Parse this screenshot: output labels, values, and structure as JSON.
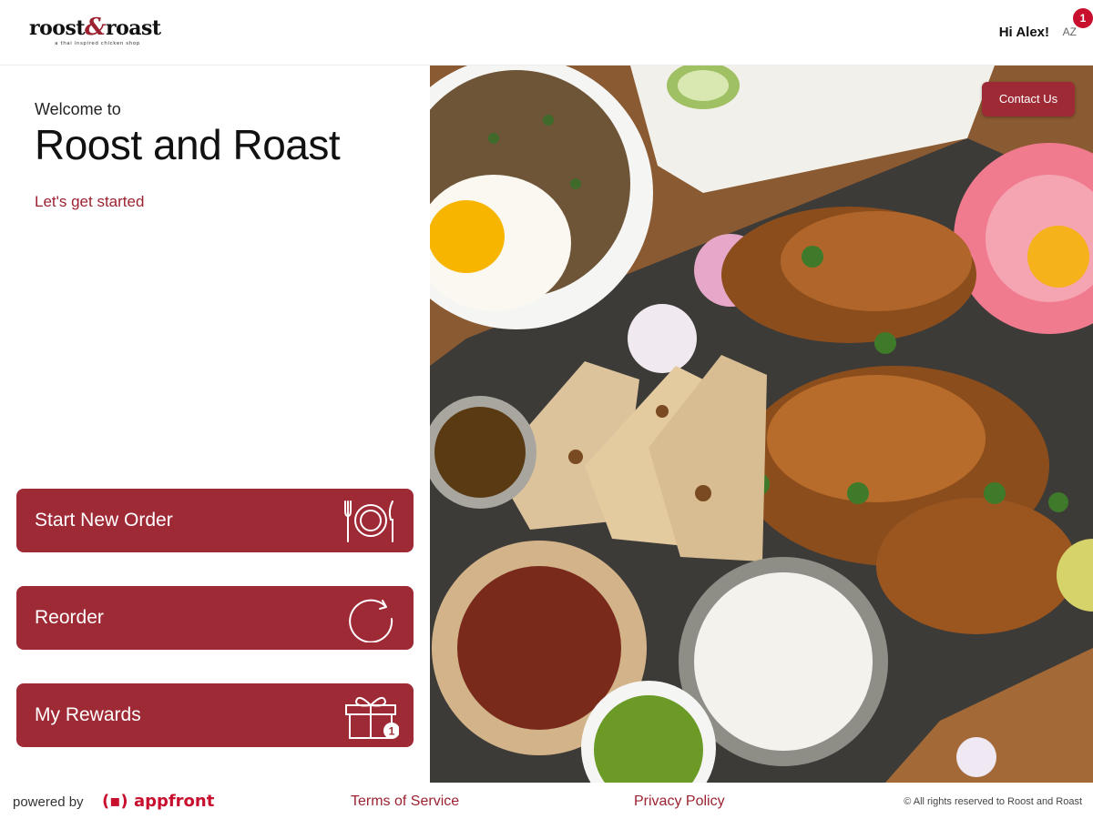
{
  "header": {
    "logo_text_left": "roost",
    "logo_amp": "&",
    "logo_text_right": "roast",
    "logo_tagline": "a thai inspired chicken shop",
    "greeting": "Hi Alex!",
    "avatar_initials": "AZ",
    "notification_count": "1"
  },
  "main": {
    "welcome_small": "Welcome to",
    "welcome_title": "Roost and Roast",
    "cta_text": "Let's get started",
    "actions": [
      {
        "label": "Start New Order",
        "icon": "plate-fork-knife-icon"
      },
      {
        "label": "Reorder",
        "icon": "refresh-circle-icon"
      },
      {
        "label": "My Rewards",
        "icon": "gift-icon",
        "badge": "1"
      }
    ]
  },
  "hero": {
    "contact_label": "Contact Us"
  },
  "footer": {
    "powered_by": "powered by",
    "brand_mark": "(▪)",
    "brand": "appfront",
    "terms": "Terms of Service",
    "privacy": "Privacy Policy",
    "rights": "© All rights reserved to Roost and Roast"
  },
  "colors": {
    "brand_red": "#9e2a35",
    "link_red": "#9c2231",
    "badge_red": "#c8102e"
  }
}
